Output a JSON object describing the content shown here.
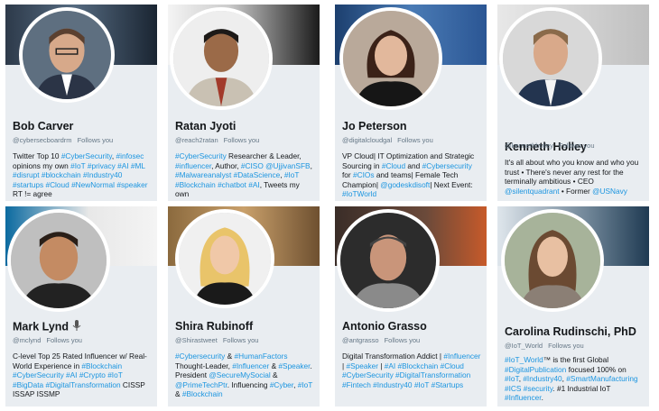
{
  "cards": [
    {
      "name": "Bob Carver",
      "handle": "@cybersecboardrm",
      "follows": "Follows you",
      "bio": [
        {
          "t": "Twitter Top 10 "
        },
        {
          "t": "#CyberSecurity",
          "tag": true
        },
        {
          "t": ", "
        },
        {
          "t": "#infosec",
          "tag": true
        },
        {
          "t": " opinions my own "
        },
        {
          "t": "#IoT",
          "tag": true
        },
        {
          "t": " "
        },
        {
          "t": "#privacy",
          "tag": true
        },
        {
          "t": " "
        },
        {
          "t": "#AI",
          "tag": true
        },
        {
          "t": " "
        },
        {
          "t": "#ML",
          "tag": true
        },
        {
          "t": " "
        },
        {
          "t": "#disrupt",
          "tag": true
        },
        {
          "t": " "
        },
        {
          "t": "#blockchain",
          "tag": true
        },
        {
          "t": " "
        },
        {
          "t": "#Industry40",
          "tag": true
        },
        {
          "t": " "
        },
        {
          "t": "#startups",
          "tag": true
        },
        {
          "t": " "
        },
        {
          "t": "#Cloud",
          "tag": true
        },
        {
          "t": " "
        },
        {
          "t": "#NewNormal",
          "tag": true
        },
        {
          "t": " "
        },
        {
          "t": "#speaker",
          "tag": true
        },
        {
          "t": " RT != agree"
        }
      ]
    },
    {
      "name": "Ratan Jyoti",
      "handle": "@reach2ratan",
      "follows": "Follows you",
      "bio": [
        {
          "t": "#CyberSecurity",
          "tag": true
        },
        {
          "t": " Researcher & Leader, "
        },
        {
          "t": "#influencer",
          "tag": true
        },
        {
          "t": ", Author, "
        },
        {
          "t": "#CISO",
          "tag": true
        },
        {
          "t": " "
        },
        {
          "t": "@UjjivanSFB",
          "tag": true
        },
        {
          "t": ", "
        },
        {
          "t": "#Malwareanalyst",
          "tag": true
        },
        {
          "t": " "
        },
        {
          "t": "#DataScience",
          "tag": true
        },
        {
          "t": ", "
        },
        {
          "t": "#IoT",
          "tag": true
        },
        {
          "t": " "
        },
        {
          "t": "#Blockchain",
          "tag": true
        },
        {
          "t": " "
        },
        {
          "t": "#chatbot",
          "tag": true
        },
        {
          "t": " "
        },
        {
          "t": "#AI",
          "tag": true
        },
        {
          "t": ", Tweets my own"
        }
      ]
    },
    {
      "name": "Jo Peterson",
      "handle": "@digitalcloudgal",
      "follows": "Follows you",
      "bio": [
        {
          "t": "VP Cloud| IT Optimization and Strategic Sourcing in "
        },
        {
          "t": "#Cloud",
          "tag": true
        },
        {
          "t": " and "
        },
        {
          "t": "#Cybersecurity",
          "tag": true
        },
        {
          "t": " for "
        },
        {
          "t": "#CIOs",
          "tag": true
        },
        {
          "t": " and teams| Female Tech Champion| "
        },
        {
          "t": "@godeskdisoft",
          "tag": true
        },
        {
          "t": "| Next Event: "
        },
        {
          "t": "#IoTWorld",
          "tag": true
        }
      ]
    },
    {
      "name": "Kenneth Holley",
      "handle": "@kennethholley",
      "follows": "Follows you",
      "bio": [
        {
          "t": "It's all about who you know and who you trust • There's never any rest for the terminally ambitious • CEO "
        },
        {
          "t": "@silentquadrant",
          "tag": true
        },
        {
          "t": " • Former "
        },
        {
          "t": "@USNavy",
          "tag": true
        }
      ]
    },
    {
      "name": "Mark Lynd",
      "handle": "@mclynd",
      "follows": "Follows you",
      "bio": [
        {
          "t": "C-level Top 25 Rated Influencer w/ Real-World Experience in "
        },
        {
          "t": "#Blockchain",
          "tag": true
        },
        {
          "t": " "
        },
        {
          "t": "#CyberSecurity",
          "tag": true
        },
        {
          "t": " "
        },
        {
          "t": "#AI",
          "tag": true
        },
        {
          "t": " "
        },
        {
          "t": "#Crypto",
          "tag": true
        },
        {
          "t": " "
        },
        {
          "t": "#IoT",
          "tag": true
        },
        {
          "t": " "
        },
        {
          "t": "#BigData",
          "tag": true
        },
        {
          "t": " "
        },
        {
          "t": "#DigitalTransformation",
          "tag": true
        },
        {
          "t": " CISSP ISSAP ISSMP"
        }
      ]
    },
    {
      "name": "Shira Rubinoff",
      "handle": "@Shirastweet",
      "follows": "Follows you",
      "bio": [
        {
          "t": "#Cybersecurity",
          "tag": true
        },
        {
          "t": " & "
        },
        {
          "t": "#HumanFactors",
          "tag": true
        },
        {
          "t": " Thought-Leader, "
        },
        {
          "t": "#Influencer",
          "tag": true
        },
        {
          "t": " & "
        },
        {
          "t": "#Speaker",
          "tag": true
        },
        {
          "t": ". President "
        },
        {
          "t": "@SecureMySocial",
          "tag": true
        },
        {
          "t": " & "
        },
        {
          "t": "@PrimeTechPtr",
          "tag": true
        },
        {
          "t": ". Influencing "
        },
        {
          "t": "#Cyber",
          "tag": true
        },
        {
          "t": ", "
        },
        {
          "t": "#IoT",
          "tag": true
        },
        {
          "t": " & "
        },
        {
          "t": "#Blockchain",
          "tag": true
        }
      ]
    },
    {
      "name": "Antonio Grasso",
      "handle": "@antgrasso",
      "follows": "Follows you",
      "bio": [
        {
          "t": "Digital Transformation Addict | "
        },
        {
          "t": "#Influencer",
          "tag": true
        },
        {
          "t": " | "
        },
        {
          "t": "#Speaker",
          "tag": true
        },
        {
          "t": " | "
        },
        {
          "t": "#AI",
          "tag": true
        },
        {
          "t": " "
        },
        {
          "t": "#Blockchain",
          "tag": true
        },
        {
          "t": " "
        },
        {
          "t": "#Cloud",
          "tag": true
        },
        {
          "t": " "
        },
        {
          "t": "#CyberSecurity",
          "tag": true
        },
        {
          "t": " "
        },
        {
          "t": "#DigitalTransformation",
          "tag": true
        },
        {
          "t": " "
        },
        {
          "t": "#Fintech",
          "tag": true
        },
        {
          "t": " "
        },
        {
          "t": "#Industry40",
          "tag": true
        },
        {
          "t": " "
        },
        {
          "t": "#IoT",
          "tag": true
        },
        {
          "t": " "
        },
        {
          "t": "#Startups",
          "tag": true
        }
      ]
    },
    {
      "name": "Carolina Rudinschi, PhD",
      "handle": "@IoT_World",
      "follows": "Follows you",
      "bio": [
        {
          "t": "#IoT_World",
          "tag": true
        },
        {
          "t": "™ is the first Global "
        },
        {
          "t": "#DigitalPublication",
          "tag": true
        },
        {
          "t": " focused 100% on "
        },
        {
          "t": "#IoT",
          "tag": true
        },
        {
          "t": ", "
        },
        {
          "t": "#Industry40",
          "tag": true
        },
        {
          "t": ", "
        },
        {
          "t": "#SmartManufacturing",
          "tag": true
        },
        {
          "t": " "
        },
        {
          "t": "#ICS",
          "tag": true
        },
        {
          "t": " "
        },
        {
          "t": "#security",
          "tag": true
        },
        {
          "t": ". #1 Industrial IoT "
        },
        {
          "t": "#Influencer",
          "tag": true
        },
        {
          "t": "."
        }
      ]
    }
  ],
  "colors": {
    "link": "#1b95e0",
    "card_bg": "#e9edf1",
    "text": "#14171a",
    "muted": "#657786"
  },
  "icons": {
    "mark_lynd_badge": "microphone-icon"
  }
}
